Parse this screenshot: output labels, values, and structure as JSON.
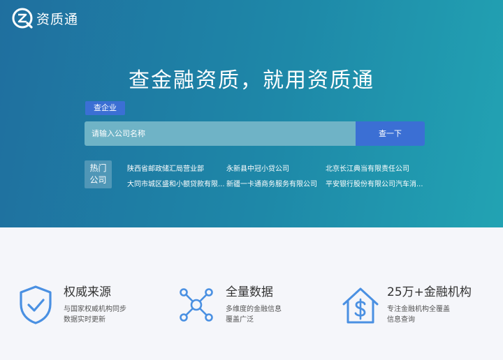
{
  "brand": {
    "name": "资质通",
    "icon": "q-logo-icon"
  },
  "hero": {
    "headline": "查金融资质，就用资质通"
  },
  "search": {
    "tab_label": "查企业",
    "placeholder": "请输入公司名称",
    "button_label": "查一下"
  },
  "hot": {
    "label_line1": "热门",
    "label_line2": "公司",
    "items": [
      "陕西省邮政储汇局营业部",
      "永新县中冠小贷公司",
      "北京长江典当有限责任公司",
      "大同市城区盛和小额贷款有限...",
      "新疆一卡通商务服务有限公司",
      "平安银行股份有限公司汽车消..."
    ]
  },
  "features": [
    {
      "icon": "shield-check-icon",
      "title": "权威来源",
      "desc_line1": "与国家权威机构同步",
      "desc_line2": "数据实时更新"
    },
    {
      "icon": "network-nodes-icon",
      "title": "全量数据",
      "desc_line1": "多维度的金融信息",
      "desc_line2": "覆盖广泛"
    },
    {
      "icon": "house-dollar-icon",
      "title": "25万+金融机构",
      "desc_line1": "专注金融机构全覆盖",
      "desc_line2": "信息查询"
    }
  ],
  "colors": {
    "accent": "#3b6fd4",
    "hero_start": "#1f6f9f",
    "hero_end": "#22a3b3",
    "icon_blue": "#4a90e2"
  }
}
